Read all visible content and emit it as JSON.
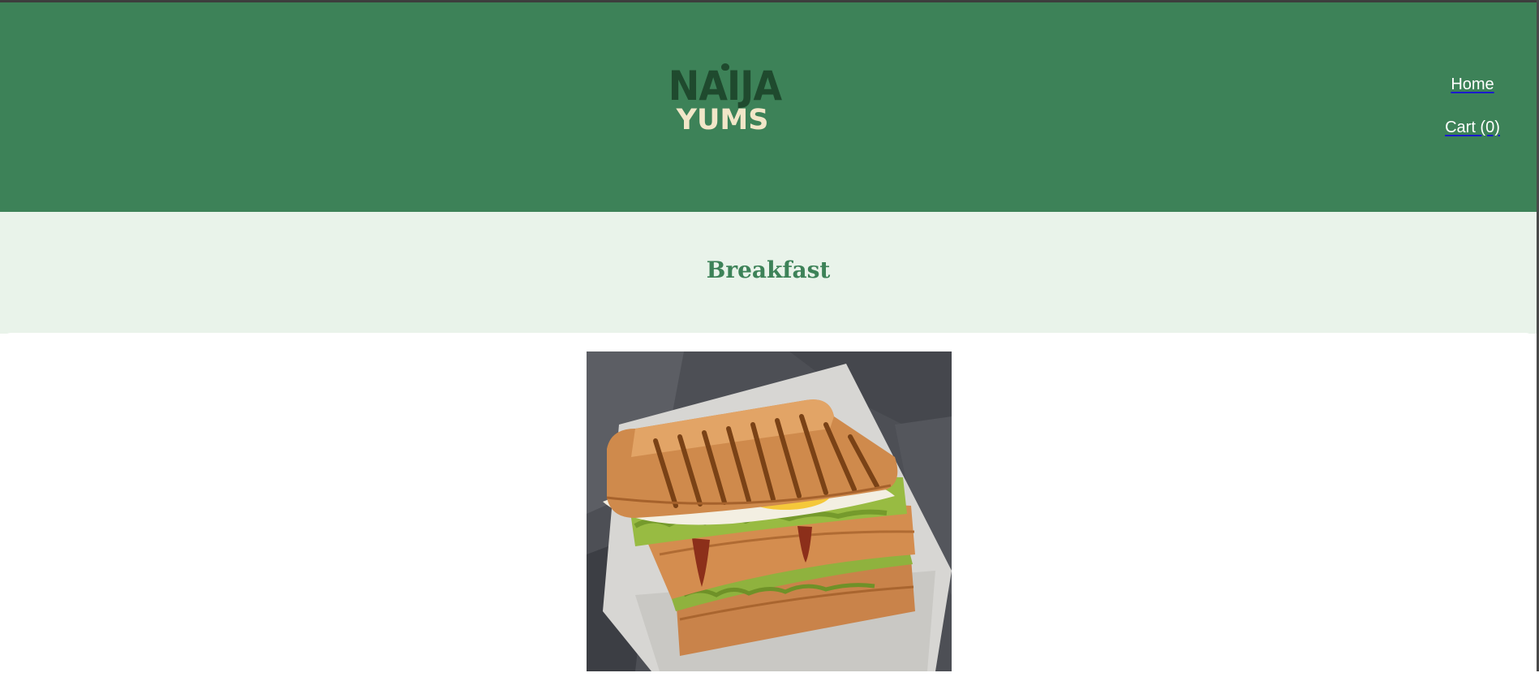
{
  "header": {
    "logo_line1": "NAIJA",
    "logo_line2": "YUMS",
    "background_color": "#3d8258"
  },
  "nav": {
    "home_label": "Home",
    "cart_label": "Cart (0)"
  },
  "section": {
    "title": "Breakfast"
  },
  "product": {
    "image_icon": "grilled-sandwich-image"
  }
}
